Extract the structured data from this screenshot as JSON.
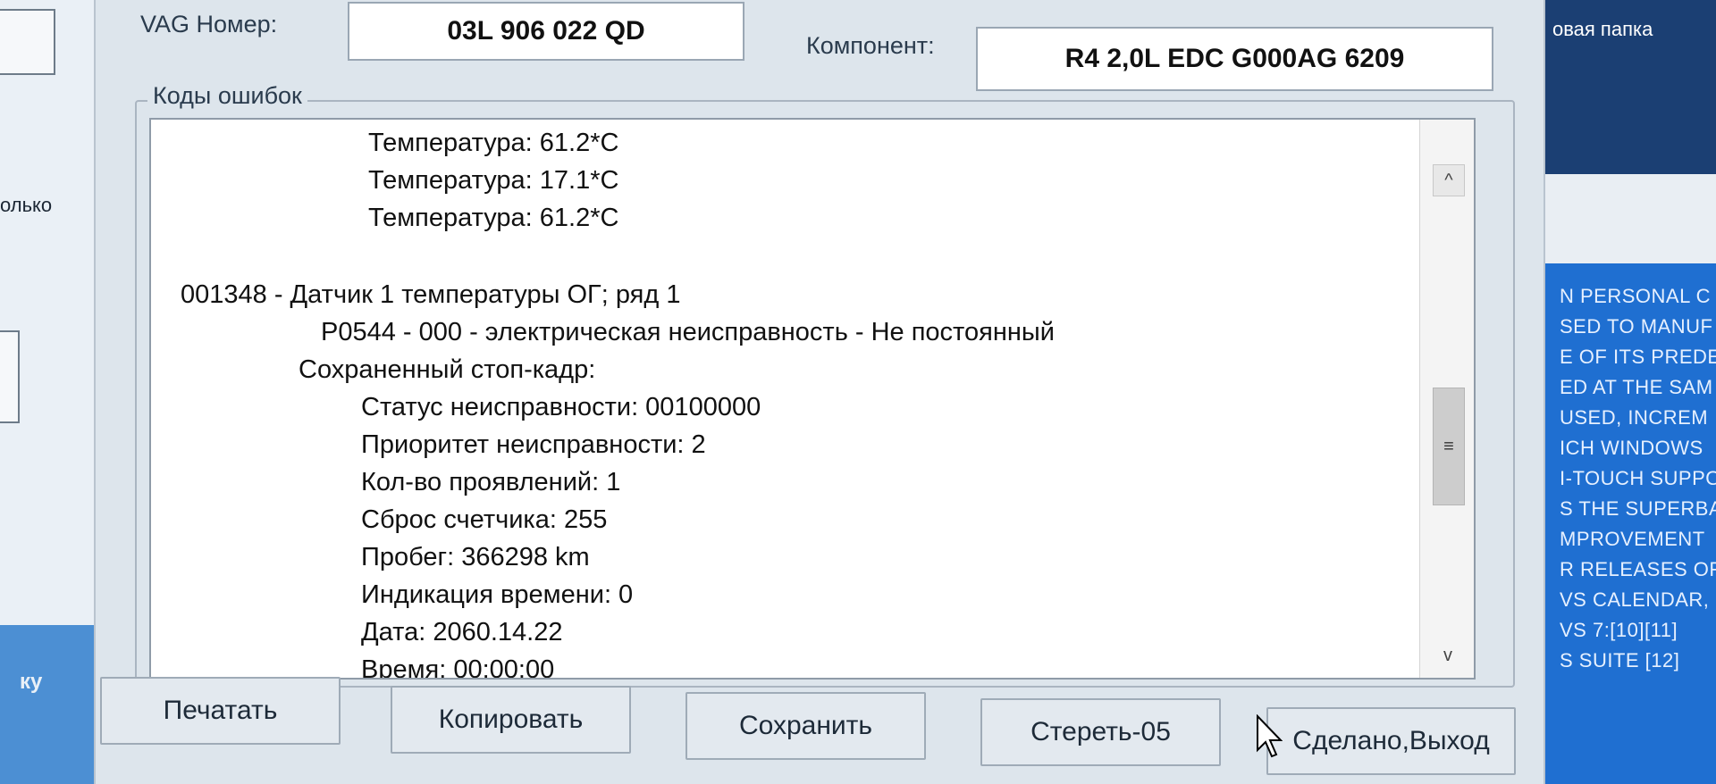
{
  "background_left": {
    "text_partial_1": "олько",
    "text_partial_2": "ку"
  },
  "background_right": {
    "folder_label": "овая папка",
    "news_lines": [
      "N PERSONAL C",
      "SED TO MANUF",
      "E OF ITS PREDE",
      "ED AT THE SAM",
      "USED, INCREM",
      "ICH WINDOWS",
      "I-TOUCH SUPPO",
      "S THE SUPERBA",
      "MPROVEMENT",
      "R RELEASES OF",
      "VS CALENDAR,",
      "VS 7:[10][11]",
      "S SUITE [12]"
    ]
  },
  "header": {
    "vag_label": "VAG Номер:",
    "vag_value": "03L 906 022 QD",
    "component_label": "Компонент:",
    "component_value": "R4 2,0L EDC G000AG  6209"
  },
  "codes": {
    "group_title": "Коды ошибок",
    "lines": [
      "Температура: 61.2*C",
      "Температура: 17.1*C",
      "Температура: 61.2*C",
      "001348 - Датчик 1 температуры ОГ; ряд 1",
      "P0544 - 000 - электрическая неисправность - Не постоянный",
      "Сохраненный стоп-кадр:",
      "Статус неисправности: 00100000",
      "Приоритет неисправности: 2",
      "Кол-во проявлений: 1",
      "Сброс счетчика: 255",
      "Пробег: 366298 km",
      "Индикация времени: 0",
      "Дата: 2060.14.22",
      "Время: 00:00:00"
    ]
  },
  "scrollbar": {
    "up_glyph": "^",
    "thumb_glyph": "≡",
    "down_glyph": "v"
  },
  "buttons": {
    "print": "Печатать",
    "copy": "Копировать",
    "save": "Сохранить",
    "clear": "Стереть-05",
    "done": "Сделано,Выход"
  }
}
